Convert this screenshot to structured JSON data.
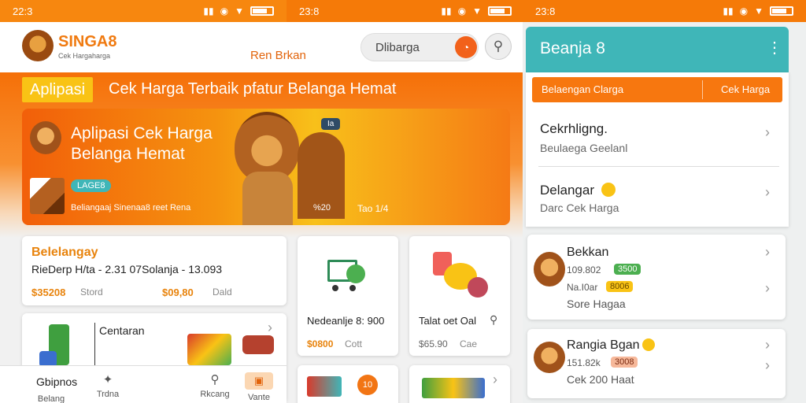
{
  "status": {
    "left_time": "22:3",
    "mid_time": "23:8",
    "right_time": "23:8"
  },
  "header": {
    "brand_name": "SINGA8",
    "brand_tagline": "Cek Hargaharga",
    "center_link": "Ren Brkan",
    "search_text": "Dlibarga"
  },
  "banner": {
    "badge": "Aplipasi",
    "headline": "Cek Harga Terbaik pfatur Belanga Hemat",
    "hero_title_1": "Aplipasi Cek Harga",
    "hero_title_2": "Belanga Hemat",
    "hero_chip": "LAGE8",
    "hero_caption": "Beliangaaj Sinenaa8 reet Rena",
    "hero_tag_top": "Ia",
    "hero_tag_mid": "%20",
    "hero_tag_right": "Tao 1/4"
  },
  "products": [
    {
      "title": "Belelangay",
      "line": "RieDerp  H/ta - 2.31  07Solanja - 13.093",
      "price_1": "$35208",
      "note_1": "Stord",
      "price_2": "$09,80",
      "note_2": "Dald"
    },
    {
      "title": "Nedeanlje 8: 900",
      "price": "$0800",
      "note": "Cott"
    },
    {
      "title": "Talat oet Oal",
      "price": "$65.90",
      "note": "Cae"
    },
    {
      "title": "Centaran"
    }
  ],
  "bottom_nav": [
    {
      "icon": "grid-icon",
      "label": "Belang",
      "title": "Gbipnos"
    },
    {
      "icon": "pin-icon",
      "label": "Trdna",
      "title": ""
    },
    {
      "icon": "search-icon",
      "label": "Rkcang",
      "title": ""
    },
    {
      "icon": "user-icon",
      "label": "Vante",
      "title": ""
    }
  ],
  "right_panel": {
    "title": "Beanja 8",
    "tab_left": "Belaengan Clarga",
    "tab_right": "Cek Harga",
    "list_a": [
      {
        "title": "Cekrhligng.",
        "subtitle": "Beulaega Geelanl"
      },
      {
        "title": "Delangar",
        "subtitle": "Darc Cek Harga"
      }
    ],
    "card_b": {
      "title": "Bekkan",
      "line_1": "109.802",
      "chip_1": "3500",
      "line_2": "Na.I0ar",
      "chip_2": "8006",
      "footer": "Sore Hagaa"
    },
    "card_c": {
      "title": "Rangia Bgan",
      "line_1": "151.82k",
      "chip_1": "3008",
      "footer": "Cek 200 Haat"
    }
  },
  "colors": {
    "orange": "#f7770f",
    "teal": "#3fb6b8",
    "yellow": "#f9c315",
    "green": "#4caf50"
  }
}
